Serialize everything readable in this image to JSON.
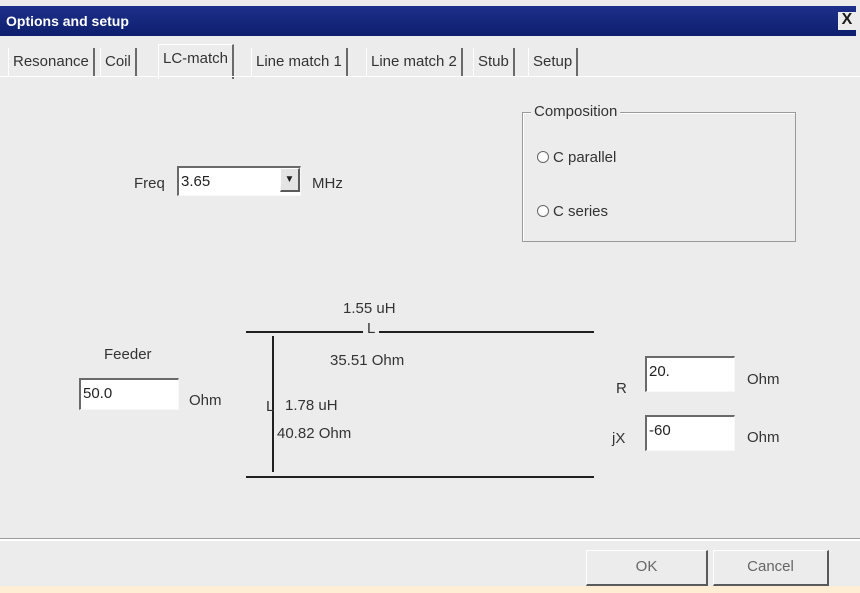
{
  "window": {
    "title": "Options and setup",
    "close_label": "X"
  },
  "tabs": [
    {
      "label": "Resonance"
    },
    {
      "label": "Coil"
    },
    {
      "label": "LC-match"
    },
    {
      "label": "Line match 1"
    },
    {
      "label": "Line match 2"
    },
    {
      "label": "Stub"
    },
    {
      "label": "Setup"
    }
  ],
  "freq": {
    "label": "Freq",
    "value": "3.65",
    "unit": "MHz"
  },
  "composition": {
    "title": "Composition",
    "options": [
      {
        "label": "C parallel"
      },
      {
        "label": "C series"
      }
    ]
  },
  "feeder": {
    "label": "Feeder",
    "value": "50.0",
    "unit": "Ohm"
  },
  "circuit": {
    "series_value": "1.55 uH",
    "series_label": "L",
    "series_reactance": "35.51 Ohm",
    "shunt_label": "L",
    "shunt_value": "1.78 uH",
    "shunt_reactance": "40.82 Ohm"
  },
  "load": {
    "r_label": "R",
    "r_value": "20.",
    "r_unit": "Ohm",
    "x_label": "jX",
    "x_value": "-60",
    "x_unit": "Ohm"
  },
  "buttons": {
    "ok": "OK",
    "cancel": "Cancel"
  }
}
